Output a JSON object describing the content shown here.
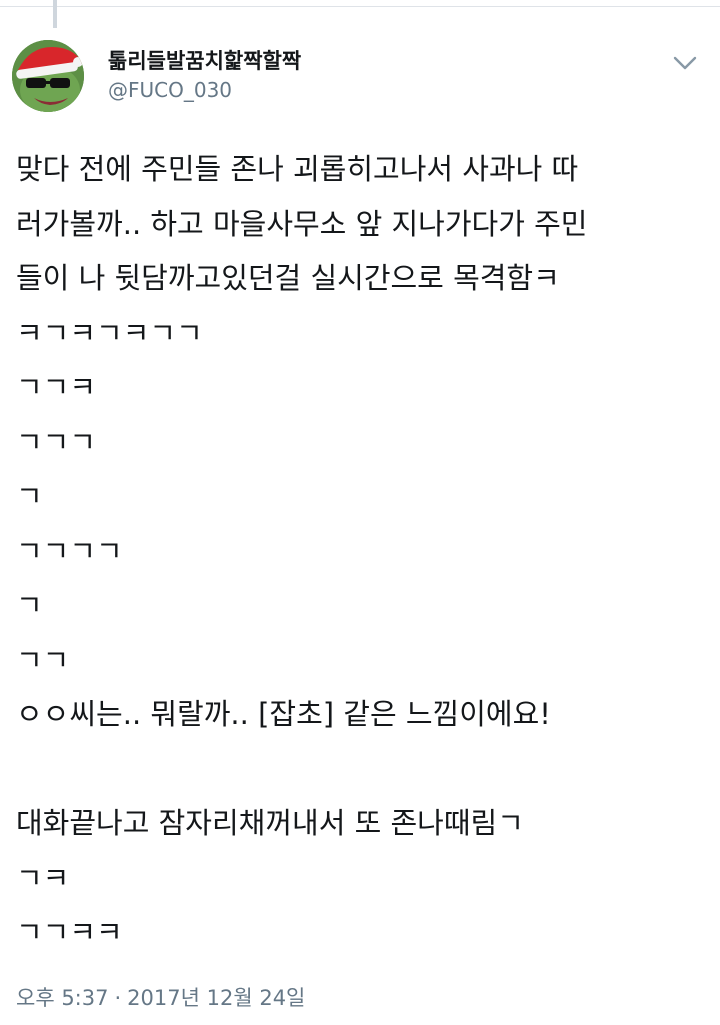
{
  "tweet": {
    "author": {
      "display_name": "톪리들발꿈치핥짝할짝",
      "handle": "@FUCO_030",
      "avatar_icon": "santa-frog-avatar-icon"
    },
    "menu_icon": "chevron-down-icon",
    "lines": [
      "맞다 전에 주민들 존나 괴롭히고나서 사과나 따",
      "러가볼까.. 하고 마을사무소 앞 지나가다가 주민",
      "들이 나 뒷담까고있던걸 실시간으로 목격함ㅋ",
      "ㅋㄱㅋㄱㅋㄱㄱ",
      "ㄱㄱㅋ",
      "ㄱㄱㄱ",
      "ㄱ",
      "ㄱㄱㄱㄱ",
      "ㄱ",
      "ㄱㄱ",
      "ㅇㅇ씨는.. 뭐랄까.. [잡초] 같은 느낌이에요!",
      "",
      "대화끝나고 잠자리채꺼내서 또 존나때림ㄱ",
      "ㄱㅋ",
      "ㄱㄱㅋㅋ"
    ],
    "time": "오후 5:37",
    "separator": "·",
    "date": "2017년 12월 24일"
  },
  "colors": {
    "text": "#14171a",
    "secondary": "#657786",
    "chevron": "#8899a6"
  }
}
